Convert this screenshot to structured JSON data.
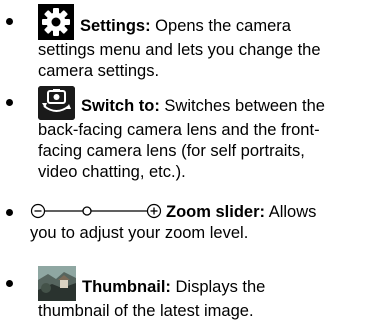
{
  "items": [
    {
      "icon": "settings-gear-icon",
      "term": "Settings:",
      "lines": [
        " Opens the camera",
        "settings menu and lets you change the",
        "camera settings."
      ]
    },
    {
      "icon": "camera-switch-icon",
      "term": "Switch to:",
      "lines": [
        " Switches between the",
        "back-facing camera lens and the front-",
        "facing camera lens (for self portraits,",
        "video chatting, etc.)."
      ]
    },
    {
      "icon": "zoom-slider-icon",
      "term": "Zoom slider:",
      "lines": [
        " Allows",
        "you to adjust your zoom level."
      ]
    },
    {
      "icon": "thumbnail-image-icon",
      "term": "Thumbnail:",
      "lines": [
        " Displays the",
        "thumbnail of the latest image."
      ]
    }
  ]
}
